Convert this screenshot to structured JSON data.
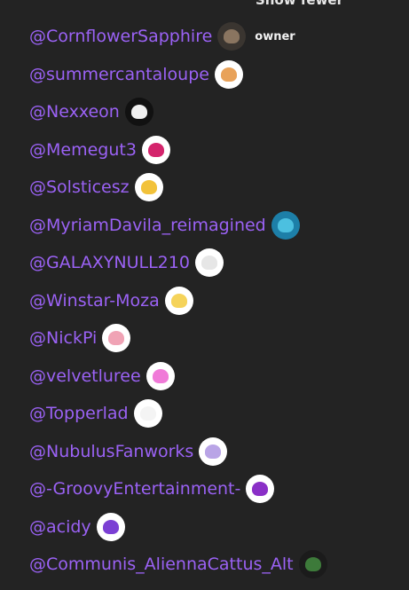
{
  "header": {
    "toggle_label": "Show fewer"
  },
  "owner_label": "owner",
  "members": [
    {
      "username": "@CornflowerSapphire",
      "avatar": "avatar-dark-blurred-icon",
      "bg": "#3a3530",
      "face": "#8a7560",
      "owner": true
    },
    {
      "username": "@summercantaloupe",
      "avatar": "avatar-cantaloupe-icon",
      "bg": "#ffffff",
      "face": "#e8a25a"
    },
    {
      "username": "@Nexxeon",
      "avatar": "avatar-white-cupcake-icon",
      "bg": "#111111",
      "face": "#f0f0f0"
    },
    {
      "username": "@Memegut3",
      "avatar": "avatar-magenta-cupcake-icon",
      "bg": "#ffffff",
      "face": "#d4246c"
    },
    {
      "username": "@Solsticesz",
      "avatar": "avatar-yellow-cupcake-icon",
      "bg": "#ffffff",
      "face": "#f2c23a"
    },
    {
      "username": "@MyriamDavila_reimagined",
      "avatar": "avatar-ocean-icon",
      "bg": "#1d7fa8",
      "face": "#4cc0e0"
    },
    {
      "username": "@GALAXYNULL210",
      "avatar": "avatar-white-ghost-icon",
      "bg": "#ffffff",
      "face": "#e6e6e6"
    },
    {
      "username": "@Winstar-Moza",
      "avatar": "avatar-yellow-cupcake-icon",
      "bg": "#ffffff",
      "face": "#f5d35a"
    },
    {
      "username": "@NickPi",
      "avatar": "avatar-pink-cupcake-icon",
      "bg": "#ffffff",
      "face": "#f0a3b5"
    },
    {
      "username": "@velvetluree",
      "avatar": "avatar-pink-cupcake-icon",
      "bg": "#ffffff",
      "face": "#f07ad8"
    },
    {
      "username": "@Topperlad",
      "avatar": "avatar-white-cupcake-icon",
      "bg": "#ffffff",
      "face": "#f4f4f4"
    },
    {
      "username": "@NubulusFanworks",
      "avatar": "avatar-lavender-cupcake-icon",
      "bg": "#ffffff",
      "face": "#b9a4e6"
    },
    {
      "username": "@-GroovyEntertainment-",
      "avatar": "avatar-purple-cupcake-icon",
      "bg": "#ffffff",
      "face": "#8a2fc7"
    },
    {
      "username": "@acidy",
      "avatar": "avatar-purple-grin-icon",
      "bg": "#ffffff",
      "face": "#7b3fd4"
    },
    {
      "username": "@Communis_AliennaCattus_Alt",
      "avatar": "avatar-green-alien-icon",
      "bg": "#1b1b1b",
      "face": "#3d7a3a"
    }
  ],
  "colors": {
    "background": "#232323",
    "link": "#9b62f5",
    "text": "#f2f2f2"
  }
}
